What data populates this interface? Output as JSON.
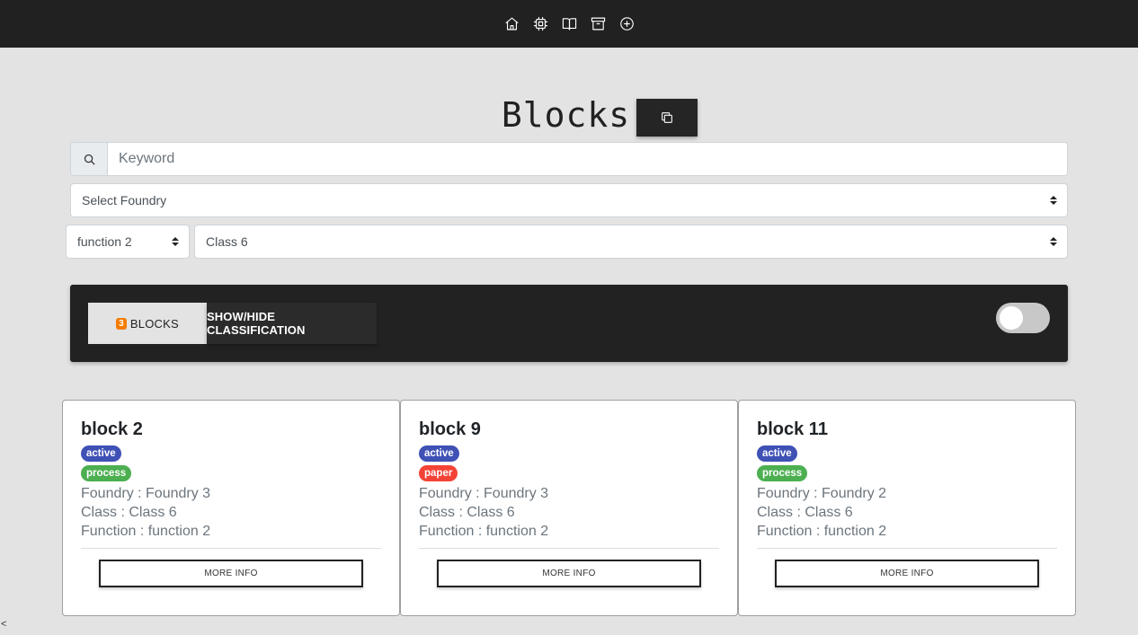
{
  "nav": {
    "icons": [
      "home-icon",
      "chip-icon",
      "book-icon",
      "archive-icon",
      "plus-circle-icon"
    ]
  },
  "header": {
    "title": "Blocks",
    "copy_icon": "copy-icon"
  },
  "search": {
    "placeholder": "Keyword",
    "value": "",
    "icon": "search-icon"
  },
  "filters": {
    "foundry": "Select Foundry",
    "function": "function 2",
    "class": "Class 6"
  },
  "toolbar": {
    "count": "3",
    "count_label": "BLOCKS",
    "classification_label": "SHOW/HIDE CLASSIFICATION",
    "toggle_on": false
  },
  "cards": [
    {
      "title": "block 2",
      "status": "active",
      "type": "process",
      "foundry": "Foundry : Foundry 3",
      "class": "Class : Class 6",
      "function": "Function : function 2",
      "button": "MORE INFO"
    },
    {
      "title": "block 9",
      "status": "active",
      "type": "paper",
      "foundry": "Foundry : Foundry 3",
      "class": "Class : Class 6",
      "function": "Function : function 2",
      "button": "MORE INFO"
    },
    {
      "title": "block 11",
      "status": "active",
      "type": "process",
      "foundry": "Foundry : Foundry 2",
      "class": "Class : Class 6",
      "function": "Function : function 2",
      "button": "MORE INFO"
    }
  ],
  "colors": {
    "topbar": "#212121",
    "badge_active": "#3f51b5",
    "badge_process": "#4caf50",
    "badge_paper": "#f44336",
    "count_badge": "#f57c00"
  },
  "corner_text": "<"
}
